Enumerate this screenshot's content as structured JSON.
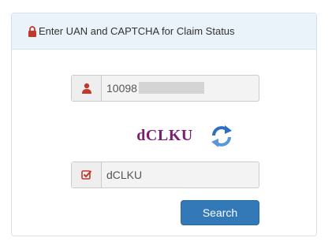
{
  "heading": {
    "icon": "lock-icon",
    "title": "Enter UAN and CAPTCHA for Claim Status"
  },
  "uan_field": {
    "icon": "user-icon",
    "value": "10098"
  },
  "captcha": {
    "image_text": "dCLKU",
    "refresh_icon": "refresh-icon"
  },
  "captcha_field": {
    "icon": "check-square-icon",
    "value": "dCLKU"
  },
  "search_button": {
    "label": "Search"
  },
  "colors": {
    "heading_bg": "#eaf3f9",
    "accent_red": "#c0392b",
    "captcha_text": "#7a1f72",
    "button_bg": "#3479b7",
    "refresh_blue": "#2f6fc0"
  }
}
